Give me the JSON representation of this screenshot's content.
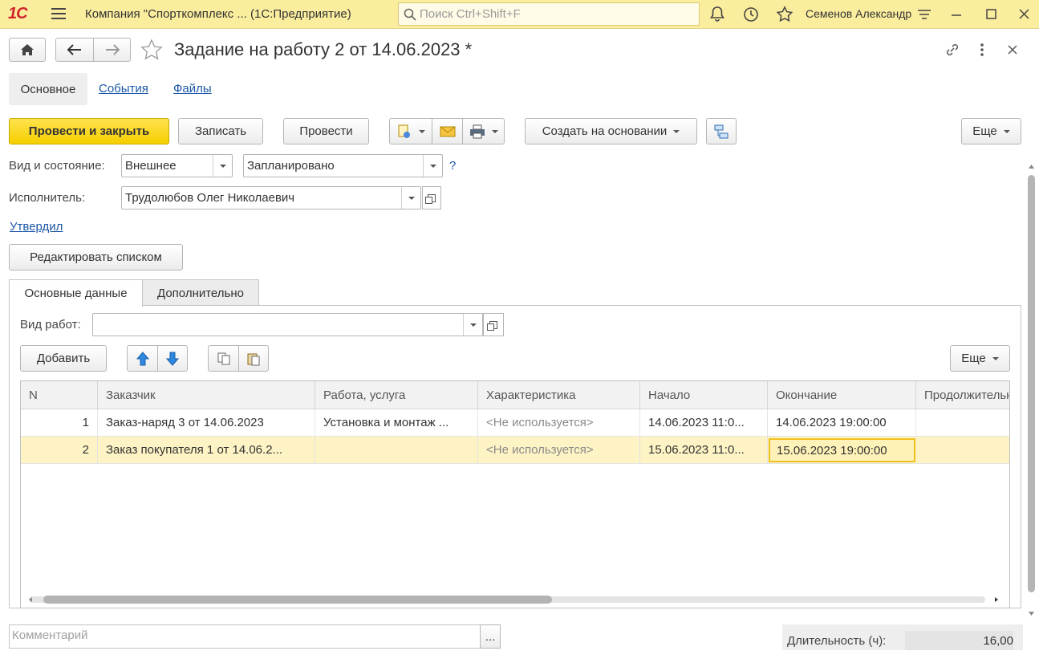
{
  "app": {
    "logo": "1С",
    "title": "Компания \"Спорткомплекс ...  (1С:Предприятие)",
    "search_placeholder": "Поиск Ctrl+Shift+F",
    "user": "Семенов Александр"
  },
  "document": {
    "title": "Задание на работу 2 от 14.06.2023 *",
    "tabs": {
      "main": "Основное",
      "events": "События",
      "files": "Файлы"
    }
  },
  "toolbar": {
    "post_close": "Провести и закрыть",
    "save": "Записать",
    "post": "Провести",
    "create_based": "Создать на основании",
    "more": "Еще"
  },
  "fields": {
    "kind_label": "Вид и состояние:",
    "kind_value": "Внешнее",
    "state_value": "Запланировано",
    "help": "?",
    "executor_label": "Исполнитель:",
    "executor_value": "Трудолюбов Олег Николаевич",
    "approved_link": "Утвердил",
    "edit_list": "Редактировать списком"
  },
  "inner_tabs": {
    "main_data": "Основные данные",
    "additional": "Дополнительно"
  },
  "works": {
    "kind_label": "Вид работ:",
    "kind_value": "",
    "add": "Добавить",
    "more": "Еще"
  },
  "table": {
    "columns": [
      "N",
      "Заказчик",
      "Работа, услуга",
      "Характеристика",
      "Начало",
      "Окончание",
      "Продолжительн"
    ],
    "rows": [
      [
        "1",
        "Заказ-наряд 3 от 14.06.2023",
        "Установка и монтаж ...",
        "<Не используется>",
        "14.06.2023 11:0...",
        "14.06.2023 19:00:00",
        ""
      ],
      [
        "2",
        "Заказ покупателя 1 от 14.06.2...",
        "",
        "<Не используется>",
        "15.06.2023 11:0...",
        "15.06.2023 19:00:00",
        ""
      ]
    ],
    "selected_row": 1
  },
  "footer": {
    "comment_placeholder": "Комментарий",
    "comment_btn": "...",
    "duration_label": "Длительность (ч):",
    "duration_value": "16,00"
  },
  "colors": {
    "accent": "#f5cf00",
    "topbar": "#fbed9e",
    "selected": "#fdf3c4",
    "link": "#1c58a7"
  }
}
